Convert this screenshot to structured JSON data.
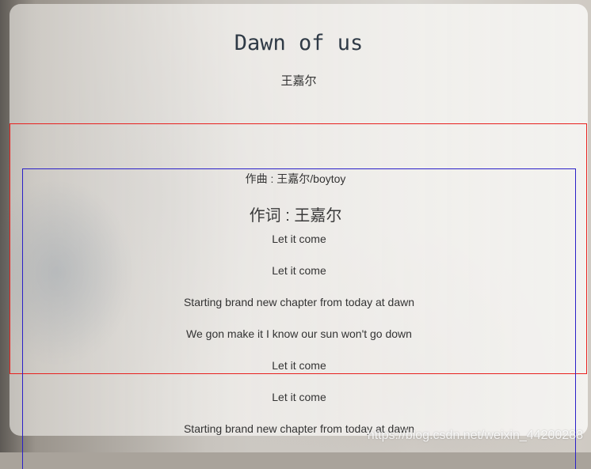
{
  "song": {
    "title": "Dawn of us",
    "artist": "王嘉尔"
  },
  "credits": {
    "composer": "作曲 : 王嘉尔/boytoy",
    "lyricist": "作词 : 王嘉尔"
  },
  "lyrics": [
    "Let it come",
    "Let it come",
    "Starting brand new chapter from today at dawn",
    "We gon make it I know our sun won't go down",
    "Let it come",
    "Let it come",
    "Starting brand new chapter from today at dawn"
  ],
  "watermark": "https://blog.csdn.net/weixin_44200288",
  "colors": {
    "outer_box": "#e8201e",
    "inner_box": "#2a20c8",
    "title_text": "#2f3a46"
  }
}
